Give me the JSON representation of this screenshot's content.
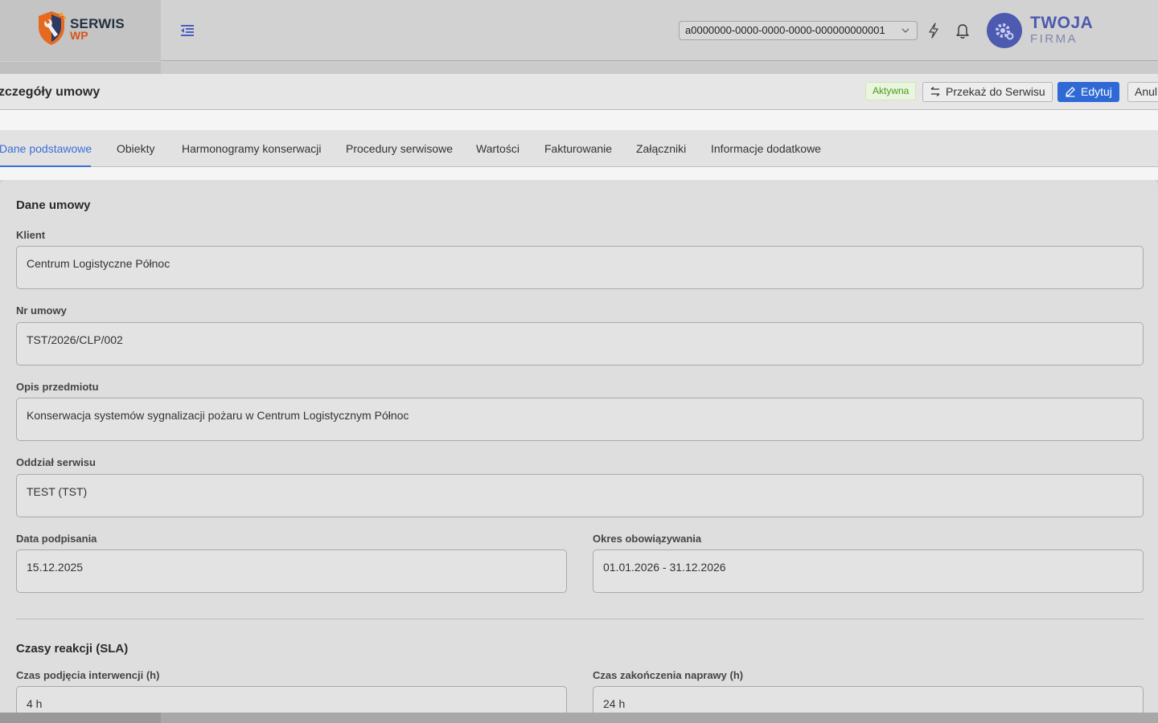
{
  "brand": {
    "line1": "SERWIS",
    "line2": "WP"
  },
  "header": {
    "tenant_value": "a0000000-0000-0000-0000-000000000001",
    "company_line1": "TWOJA",
    "company_line2": "FIRMA"
  },
  "page": {
    "title": "zczegóły umowy",
    "status_badge": "Aktywna",
    "actions": {
      "transfer": "Przekaż do Serwisu",
      "edit": "Edytuj",
      "cancel": "Anul"
    }
  },
  "tabs": [
    {
      "label": "Dane podstawowe",
      "active": true
    },
    {
      "label": "Obiekty"
    },
    {
      "label": "Harmonogramy konserwacji"
    },
    {
      "label": "Procedury serwisowe"
    },
    {
      "label": "Wartości"
    },
    {
      "label": "Fakturowanie"
    },
    {
      "label": "Załączniki"
    },
    {
      "label": "Informacje dodatkowe"
    }
  ],
  "contract": {
    "section_title": "Dane umowy",
    "client": {
      "label": "Klient",
      "value": "Centrum Logistyczne Północ"
    },
    "number": {
      "label": "Nr umowy",
      "value": "TST/2026/CLP/002"
    },
    "description": {
      "label": "Opis przedmiotu",
      "value": "Konserwacja systemów sygnalizacji pożaru w Centrum Logistycznym Północ"
    },
    "branch": {
      "label": "Oddział serwisu",
      "value": "TEST (TST)"
    },
    "signed_date": {
      "label": "Data podpisania",
      "value": "15.12.2025"
    },
    "validity": {
      "label": "Okres obowiązywania",
      "value": "01.01.2026 - 31.12.2026"
    }
  },
  "sla": {
    "section_title": "Czasy reakcji (SLA)",
    "intervention": {
      "label": "Czas podjęcia interwencji (h)",
      "value": "4 h"
    },
    "repair": {
      "label": "Czas zakończenia naprawy (h)",
      "value": "24 h"
    }
  },
  "colors": {
    "accent": "#2f69d6",
    "tab_active": "#3a6fd8",
    "badge_green": "#4a9a1a",
    "company": "#4c5aaf",
    "logo_orange": "#d8541b"
  }
}
